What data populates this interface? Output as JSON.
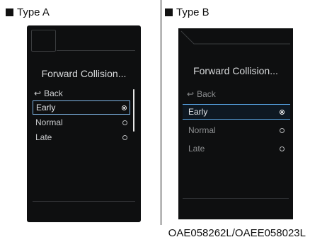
{
  "type_a": {
    "heading": "Type A",
    "screen": {
      "title": "Forward Collision...",
      "back_label": "Back",
      "back_icon": "return-arrow-icon",
      "options": [
        {
          "label": "Early",
          "selected": true
        },
        {
          "label": "Normal",
          "selected": false
        },
        {
          "label": "Late",
          "selected": false
        }
      ]
    }
  },
  "type_b": {
    "heading": "Type B",
    "screen": {
      "title": "Forward Collision...",
      "back_label": "Back",
      "back_icon": "return-arrow-icon",
      "options": [
        {
          "label": "Early",
          "selected": true
        },
        {
          "label": "Normal",
          "selected": false
        },
        {
          "label": "Late",
          "selected": false
        }
      ]
    }
  },
  "caption": "OAE058262L/OAEE058023L",
  "colors": {
    "screen_bg": "#0e0f10",
    "highlight_border_a": "#7fb6e6",
    "highlight_border_b": "#5aa8ea"
  }
}
